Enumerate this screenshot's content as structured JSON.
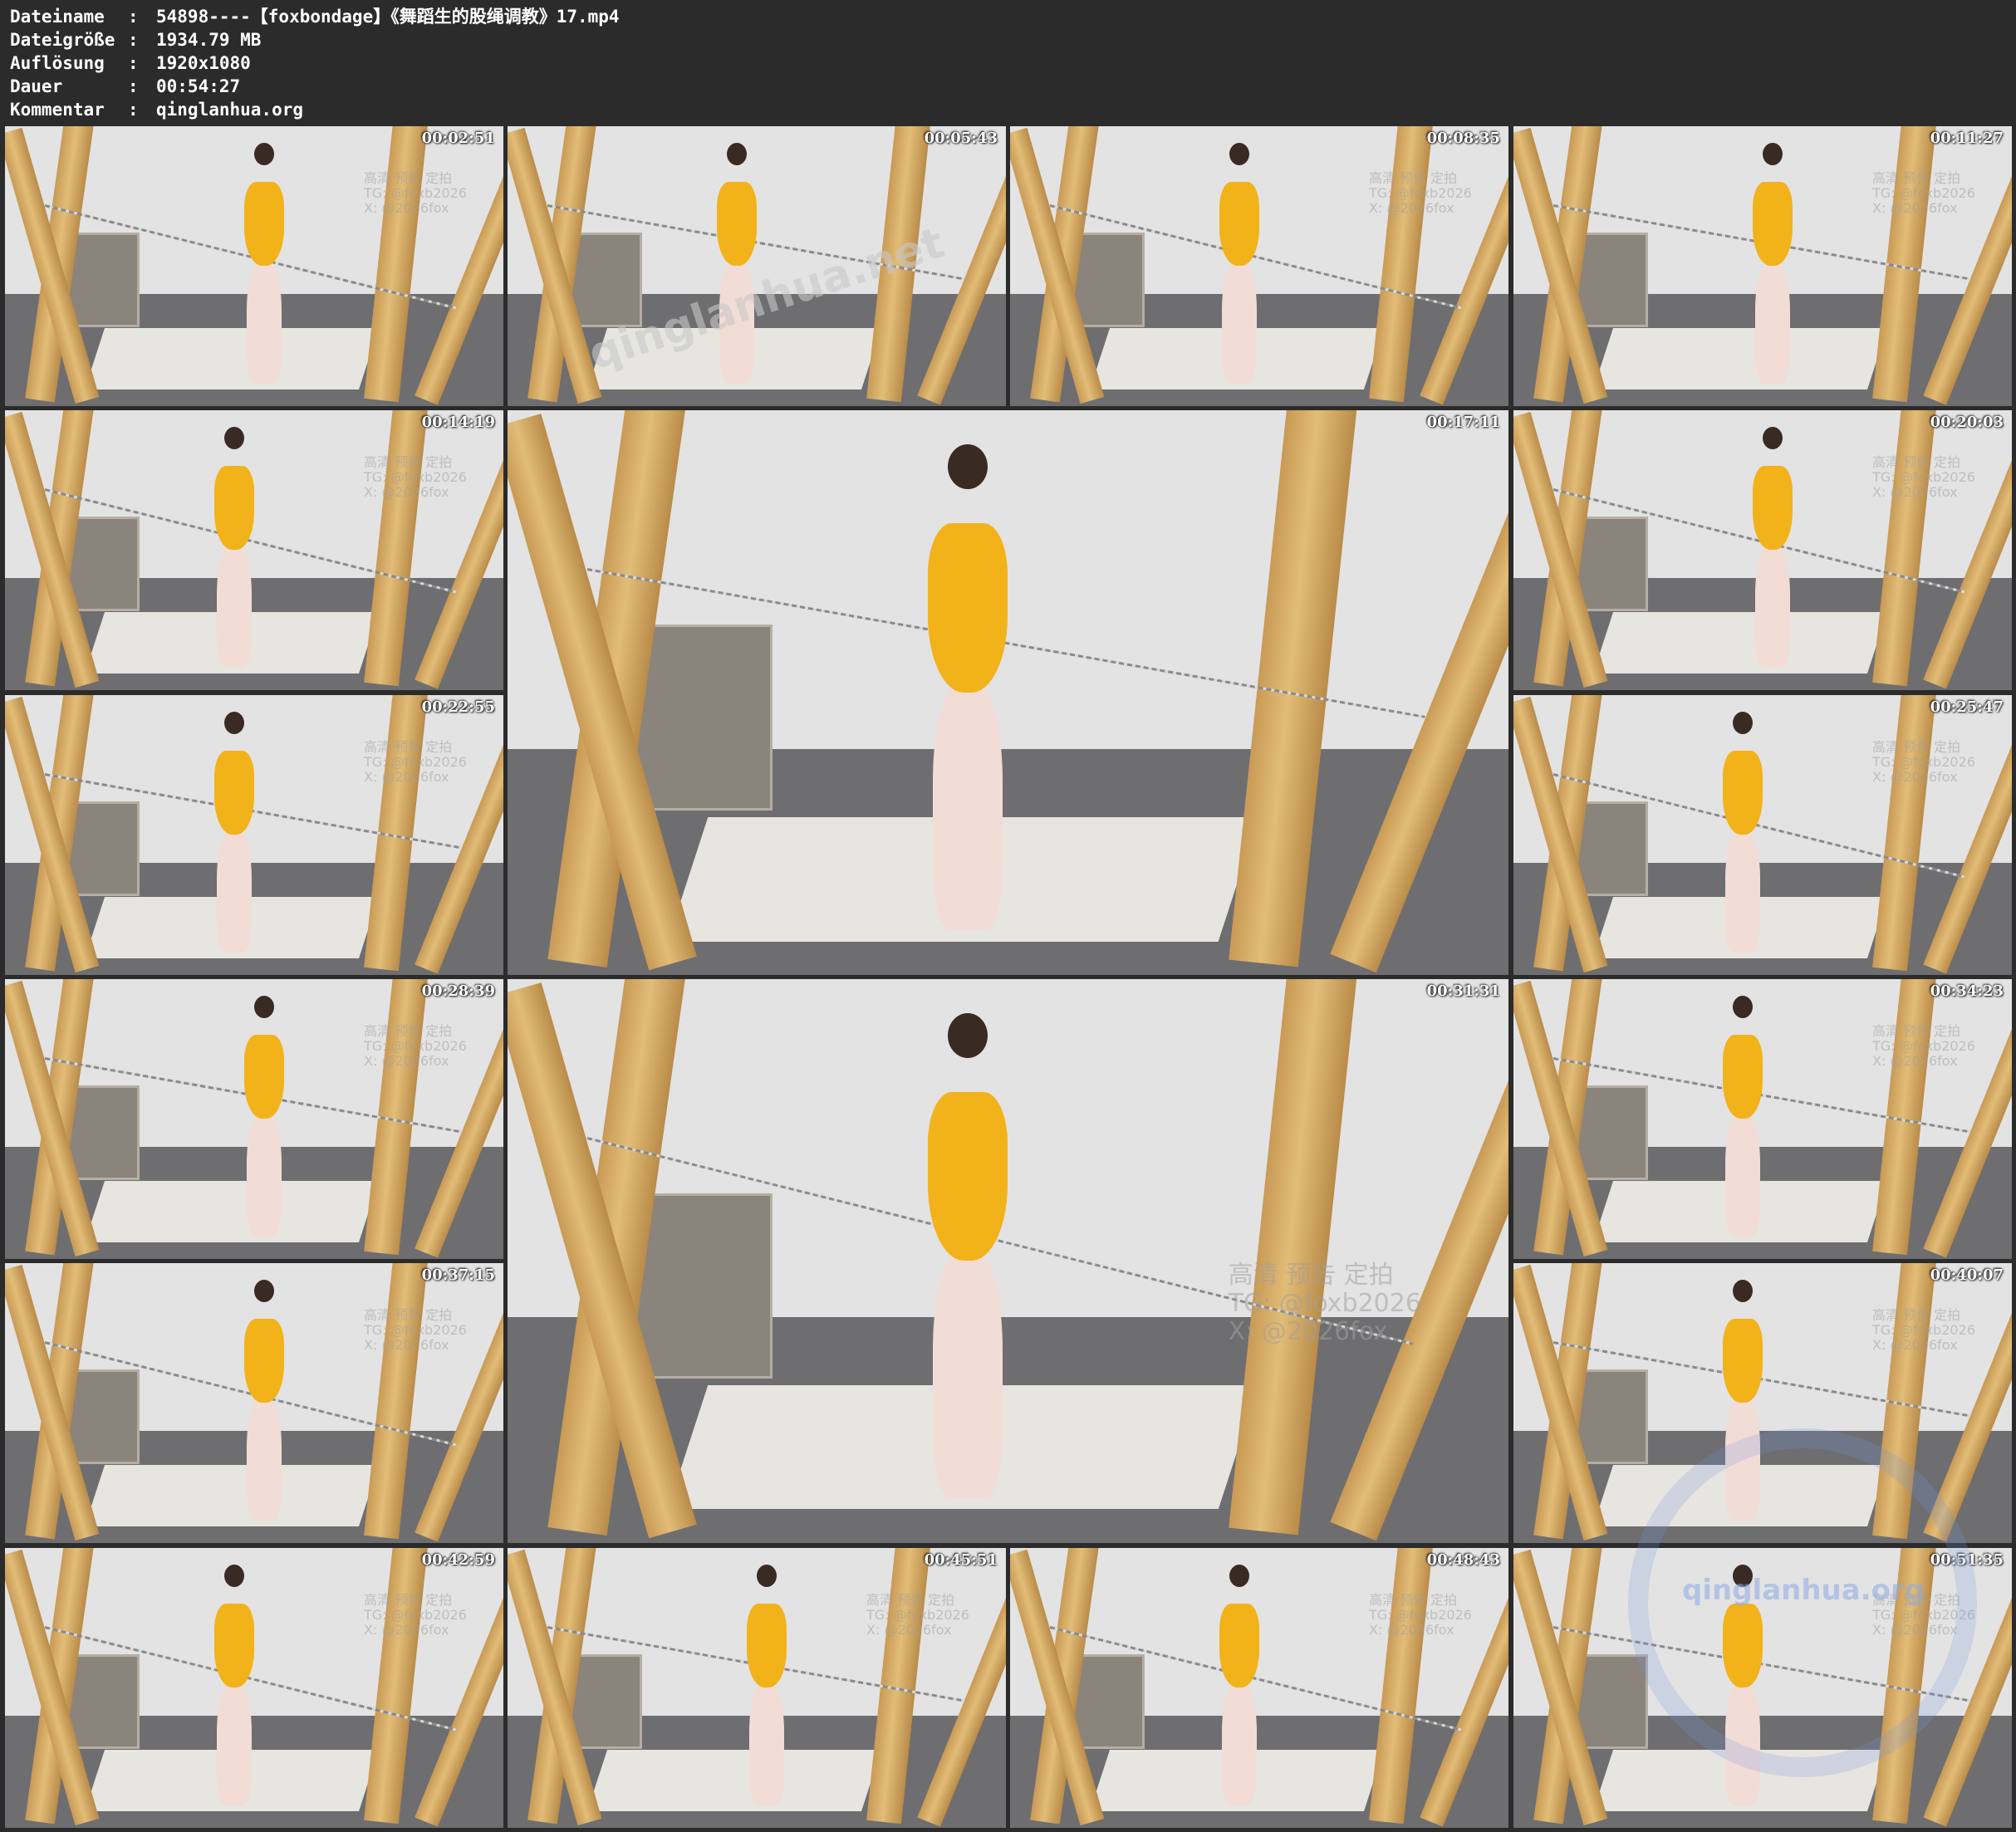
{
  "header": {
    "rows": [
      {
        "key": "Dateiname",
        "colon": ":",
        "value": "54898----【foxbondage】《舞蹈生的股绳调教》17.mp4"
      },
      {
        "key": "Dateigröße",
        "colon": ":",
        "value": "1934.79 MB"
      },
      {
        "key": "Auflösung",
        "colon": ":",
        "value": "1920x1080"
      },
      {
        "key": "Dauer",
        "colon": ":",
        "value": "00:54:27"
      },
      {
        "key": "Kommentar",
        "colon": ":",
        "value": "qinglanhua.org"
      }
    ]
  },
  "thumbnails": [
    {
      "timestamp": "00:02:51"
    },
    {
      "timestamp": "00:05:43"
    },
    {
      "timestamp": "00:08:35"
    },
    {
      "timestamp": "00:11:27"
    },
    {
      "timestamp": "00:14:19"
    },
    {
      "timestamp": "00:17:11"
    },
    {
      "timestamp": "00:20:03"
    },
    {
      "timestamp": "00:22:55"
    },
    {
      "timestamp": "00:25:47"
    },
    {
      "timestamp": "00:28:39"
    },
    {
      "timestamp": "00:31:31"
    },
    {
      "timestamp": "00:34:23"
    },
    {
      "timestamp": "00:37:15"
    },
    {
      "timestamp": "00:40:07"
    },
    {
      "timestamp": "00:42:59"
    },
    {
      "timestamp": "00:45:51"
    },
    {
      "timestamp": "00:48:43"
    },
    {
      "timestamp": "00:51:35"
    }
  ],
  "watermarks": {
    "overlay_line1": "高清 预告 定拍",
    "overlay_line2": "TG: @foxb2026",
    "overlay_line3": "X: @2026fox",
    "site_diagonal": "qinglanhua.net",
    "site_circle": "qinglanhua.org"
  }
}
